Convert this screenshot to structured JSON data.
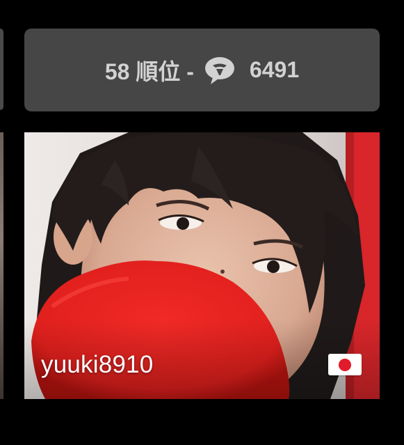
{
  "rank_card": {
    "rank_text": "58 順位 -",
    "comment_icon": "speech-bubble-icon",
    "comment_count": "6491"
  },
  "profile": {
    "username": "yuuki8910",
    "flag_icon": "japan-flag-icon"
  },
  "colors": {
    "background": "#000000",
    "card": "#464646",
    "card_text": "#d2d2d2",
    "flag_red": "#e21b2a"
  }
}
